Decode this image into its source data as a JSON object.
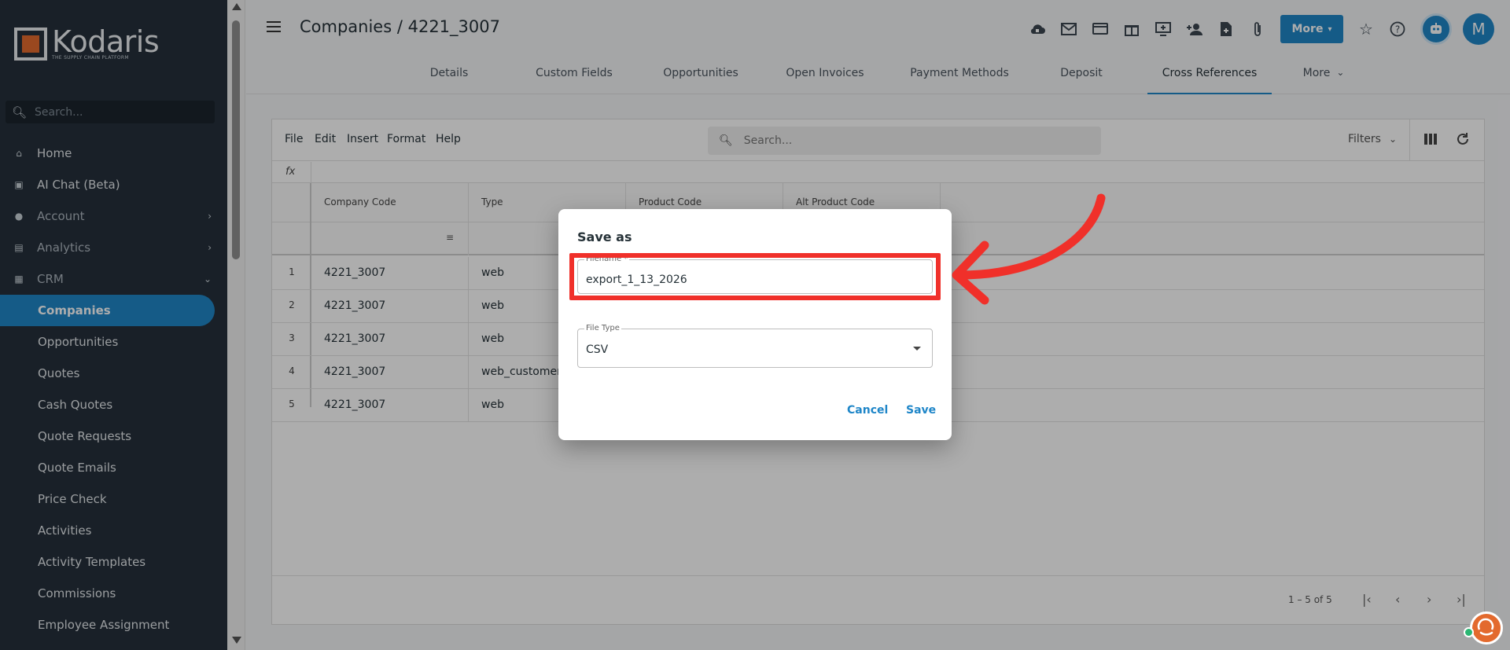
{
  "app": {
    "logo_name": "Kodaris",
    "logo_tagline": "THE SUPPLY CHAIN PLATFORM"
  },
  "sidebar": {
    "search_placeholder": "Search...",
    "items": [
      {
        "label": "Home",
        "icon": "home-icon"
      },
      {
        "label": "AI Chat (Beta)",
        "icon": "robot-icon"
      },
      {
        "label": "Account",
        "icon": "person-icon",
        "chevron": ">"
      },
      {
        "label": "Analytics",
        "icon": "chart-icon",
        "chevron": ">"
      },
      {
        "label": "CRM",
        "icon": "briefcase-icon",
        "chevron": "v"
      }
    ],
    "crm_items": [
      "Companies",
      "Opportunities",
      "Quotes",
      "Cash Quotes",
      "Quote Requests",
      "Quote Emails",
      "Price Check",
      "Activities",
      "Activity Templates",
      "Commissions",
      "Employee Assignment"
    ],
    "active_item": "Companies"
  },
  "header": {
    "title": "Companies / 4221_3007",
    "more_label": "More",
    "avatar_initial": "M"
  },
  "tabs": [
    "Details",
    "Custom Fields",
    "Opportunities",
    "Open Invoices",
    "Payment Methods",
    "Deposit",
    "Cross References",
    "More"
  ],
  "active_tab": "Cross References",
  "grid": {
    "menus": [
      "File",
      "Edit",
      "Insert",
      "Format",
      "Help"
    ],
    "search_placeholder": "Search...",
    "filters_label": "Filters",
    "fx_label": "fx",
    "columns": [
      "Company Code",
      "Type",
      "Product Code",
      "Alt Product Code"
    ],
    "rows": [
      {
        "num": "1",
        "company_code": "4221_3007",
        "type": "web"
      },
      {
        "num": "2",
        "company_code": "4221_3007",
        "type": "web"
      },
      {
        "num": "3",
        "company_code": "4221_3007",
        "type": "web"
      },
      {
        "num": "4",
        "company_code": "4221_3007",
        "type": "web_customer"
      },
      {
        "num": "5",
        "company_code": "4221_3007",
        "type": "web"
      }
    ],
    "pager_text": "1 – 5 of 5"
  },
  "dialog": {
    "title": "Save as",
    "filename_label": "Filename *",
    "filename_value": "export_1_13_2026",
    "filetype_label": "File Type",
    "filetype_value": "CSV",
    "cancel_label": "Cancel",
    "save_label": "Save"
  },
  "colors": {
    "accent": "#1f86c8",
    "sidebar_bg": "#25303b",
    "highlight": "#f0302a",
    "brand_orange": "#e36a2e"
  }
}
